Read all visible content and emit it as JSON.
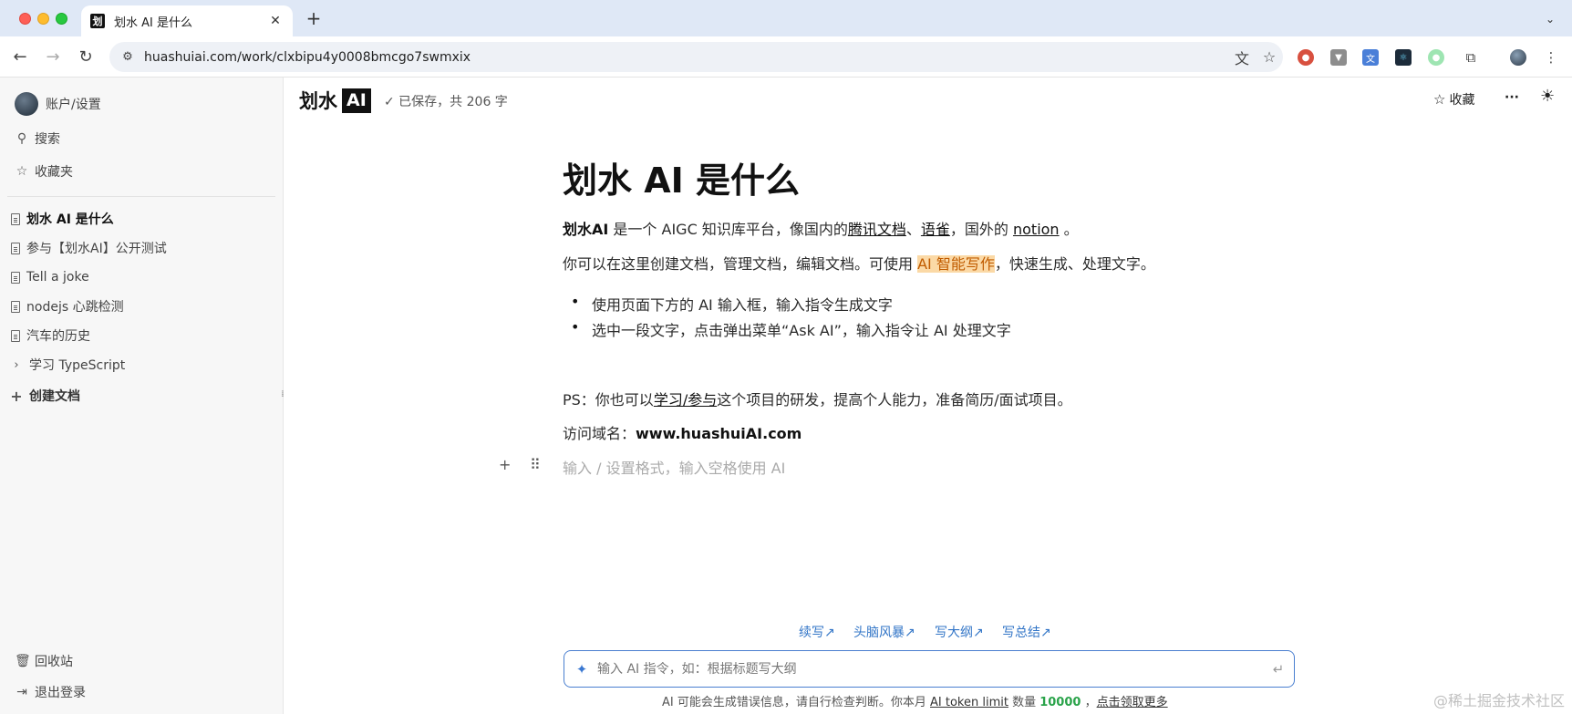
{
  "browser": {
    "tab_title": "划水 AI 是什么",
    "tab_favicon": "划",
    "close": "✕",
    "new_tab": "+",
    "tab_menu": "⌄",
    "url": "huashuiai.com/work/clxbipu4y0008bmcgo7swmxix",
    "icons": [
      "back-icon",
      "forward-icon",
      "reload-icon",
      "site-info-icon",
      "translate-icon",
      "bookmark-star-icon"
    ]
  },
  "sidebar": {
    "account": "账户/设置",
    "search": "搜索",
    "favorites": "收藏夹",
    "docs": [
      {
        "label": "划水 AI 是什么"
      },
      {
        "label": "参与【划水AI】公开测试"
      },
      {
        "label": "Tell a joke"
      },
      {
        "label": "nodejs 心跳检测"
      },
      {
        "label": "汽车的历史"
      }
    ],
    "folder": "学习 TypeScript",
    "create": "创建文档",
    "trash": "回收站",
    "logout": "退出登录"
  },
  "header": {
    "logo_text": "划水",
    "logo_ai": "AI",
    "saved_status": "✓ 已保存，共 206 字",
    "favorite": "收藏",
    "more": "···",
    "theme": "☀"
  },
  "document": {
    "title": "划水 AI 是什么",
    "p1": {
      "bold": "划水AI",
      "text1": " 是一个 AIGC 知识库平台，像国内的",
      "link1": "腾讯文档",
      "sep": "、",
      "link2": "语雀",
      "text2": "，国外的 ",
      "link3": "notion",
      "text3": " 。"
    },
    "p2": {
      "text1": "你可以在这里创建文档，管理文档，编辑文档。可使用 ",
      "highlight": "AI 智能写作",
      "text2": "，快速生成、处理文字。"
    },
    "bullets": [
      "使用页面下方的 AI 输入框，输入指令生成文字",
      "选中一段文字，点击弹出菜单“Ask AI”，输入指令让 AI 处理文字"
    ],
    "p3": {
      "text1": "PS：你也可以",
      "link": "学习/参与",
      "text2": "这个项目的研发，提高个人能力，准备简历/面试项目。"
    },
    "p4": {
      "text": "访问域名：",
      "bold": "www.huashuiAI.com"
    },
    "empty_placeholder": "输入 / 设置格式，输入空格使用 AI"
  },
  "ai": {
    "quick_actions": [
      "续写↗",
      "头脑风暴↗",
      "写大纲↗",
      "写总结↗"
    ],
    "placeholder": "输入 AI 指令，如：根据标题写大纲",
    "footnote_text": "AI 可能会生成错误信息，请自行检查判断。你本月 ",
    "footnote_link": "AI token limit",
    "footnote_text2": " 数量 ",
    "footnote_num": "10000",
    "footnote_text3": " ，",
    "footnote_link2": "点击领取更多"
  },
  "watermark": "@稀土掘金技术社区",
  "colors": {
    "accent": "#3275c7",
    "highlight_bg": "#fbd9a6",
    "highlight_fg": "#c15c00",
    "quota": "#2aa34a"
  }
}
